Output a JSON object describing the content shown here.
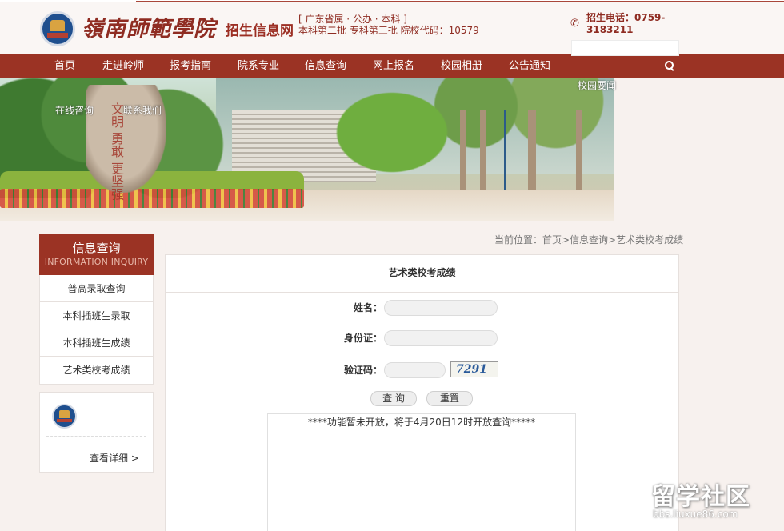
{
  "header": {
    "school_name": "嶺南師範學院",
    "site_name": "招生信息网",
    "tag_line_1": "[ 广东省属 · 公办 · 本科 ]",
    "tag_line_2": "本科第二批  专科第三批  院校代码：10579",
    "phone_label": "招生电话：0759-3183211",
    "search_placeholder": ""
  },
  "nav": {
    "items": [
      "首页",
      "走进岭师",
      "报考指南",
      "院系专业",
      "信息查询",
      "网上报名",
      "校园相册",
      "公告通知"
    ],
    "dropdown_links": [
      "校园要闻",
      "在线咨询",
      "联系我们"
    ]
  },
  "banner": {
    "rock_text": "文明 勇敢 更坚强"
  },
  "sidebar": {
    "title": "信息查询",
    "subtitle": "INFORMATION INQUIRY",
    "items": [
      "普高录取查询",
      "本科插班生录取",
      "本科插班生成绩",
      "艺术类校考成绩"
    ],
    "card_link": "查看详细 >"
  },
  "breadcrumb": "当前位置：首页>信息查询>艺术类校考成绩",
  "main": {
    "title": "艺术类校考成绩",
    "form": {
      "name_label": "姓名：",
      "id_label": "身份证：",
      "captcha_label": "验证码：",
      "captcha_value": "7291",
      "query_button": "查 询",
      "reset_button": "重置"
    },
    "result_text": "****功能暂未开放，将于4月20日12时开放查询*****"
  },
  "watermark": {
    "big": "留学社区",
    "small": "bbs.liuxue86.com"
  },
  "colors": {
    "brand": "#9b3324",
    "background": "#f7f1ee"
  }
}
